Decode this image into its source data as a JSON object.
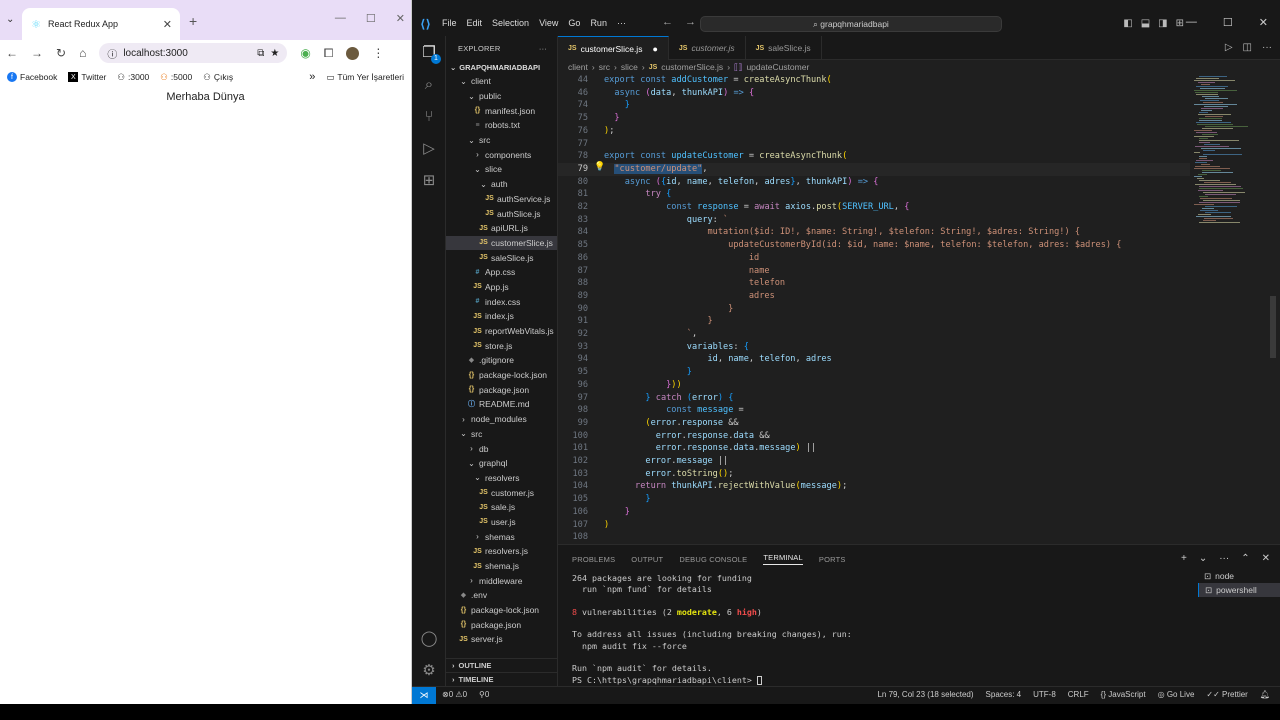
{
  "browser": {
    "tab_title": "React Redux App",
    "url": "localhost:3000",
    "bookmarks": [
      "Facebook",
      "Twitter",
      ":3000",
      ":5000",
      "Çıkış"
    ],
    "bookmarks_more": "»",
    "all_bookmarks": "Tüm Yer İşaretleri",
    "content_text": "Merhaba Dünya"
  },
  "vscode": {
    "menu": [
      "File",
      "Edit",
      "Selection",
      "View",
      "Go",
      "Run",
      "···"
    ],
    "command_center": "grapqhmariadbapi",
    "explorer_title": "EXPLORER",
    "explorer_more": "···",
    "root_folder": "GRAPQHMARIADBAPI",
    "tree": [
      {
        "label": "client",
        "icon": "chev-open"
      },
      {
        "label": "public",
        "icon": "chev-open"
      },
      {
        "label": "manifest.json",
        "icon": "json"
      },
      {
        "label": "robots.txt",
        "icon": "txt"
      },
      {
        "label": "src",
        "icon": "chev-open"
      },
      {
        "label": "components",
        "icon": "chev-closed"
      },
      {
        "label": "slice",
        "icon": "chev-open"
      },
      {
        "label": "auth",
        "icon": "chev-open"
      },
      {
        "label": "authService.js",
        "icon": "js"
      },
      {
        "label": "authSlice.js",
        "icon": "js"
      },
      {
        "label": "apiURL.js",
        "icon": "js"
      },
      {
        "label": "customerSlice.js",
        "icon": "js"
      },
      {
        "label": "saleSlice.js",
        "icon": "js"
      },
      {
        "label": "App.css",
        "icon": "css"
      },
      {
        "label": "App.js",
        "icon": "js"
      },
      {
        "label": "index.css",
        "icon": "css"
      },
      {
        "label": "index.js",
        "icon": "js"
      },
      {
        "label": "reportWebVitals.js",
        "icon": "js"
      },
      {
        "label": "store.js",
        "icon": "js"
      },
      {
        "label": ".gitignore",
        "icon": "dot"
      },
      {
        "label": "package-lock.json",
        "icon": "json"
      },
      {
        "label": "package.json",
        "icon": "json"
      },
      {
        "label": "README.md",
        "icon": "info"
      },
      {
        "label": "node_modules",
        "icon": "chev-closed"
      },
      {
        "label": "src",
        "icon": "chev-open"
      },
      {
        "label": "db",
        "icon": "chev-closed"
      },
      {
        "label": "graphql",
        "icon": "chev-open"
      },
      {
        "label": "resolvers",
        "icon": "chev-open"
      },
      {
        "label": "customer.js",
        "icon": "js"
      },
      {
        "label": "sale.js",
        "icon": "js"
      },
      {
        "label": "user.js",
        "icon": "js"
      },
      {
        "label": "shemas",
        "icon": "chev-closed"
      },
      {
        "label": "resolvers.js",
        "icon": "js"
      },
      {
        "label": "shema.js",
        "icon": "js"
      },
      {
        "label": "middleware",
        "icon": "chev-closed"
      },
      {
        "label": ".env",
        "icon": "dot"
      },
      {
        "label": "package-lock.json",
        "icon": "json"
      },
      {
        "label": "package.json",
        "icon": "json"
      },
      {
        "label": "server.js",
        "icon": "js"
      }
    ],
    "outline_label": "OUTLINE",
    "timeline_label": "TIMELINE",
    "tabs": [
      {
        "label": "customerSlice.js",
        "active": true,
        "modified": true
      },
      {
        "label": "customer.js",
        "active": false,
        "modified": false
      },
      {
        "label": "saleSlice.js",
        "active": false,
        "modified": false
      }
    ],
    "breadcrumb": [
      "client",
      "src",
      "slice",
      "customerSlice.js",
      "updateCustomer"
    ],
    "panel_tabs": [
      "PROBLEMS",
      "OUTPUT",
      "DEBUG CONSOLE",
      "TERMINAL",
      "PORTS"
    ],
    "terminal_lines": [
      "264 packages are looking for funding",
      "  run `npm fund` for details",
      "",
      "8 vulnerabilities (2 moderate, 6 high)",
      "",
      "To address all issues (including breaking changes), run:",
      "  npm audit fix --force",
      "",
      "Run `npm audit` for details.",
      "PS C:\\https\\grapqhmariadbapi\\client> "
    ],
    "terminal_vuln": {
      "count": "8",
      "pre": " vulnerabilities (2 ",
      "moderate": "moderate",
      "mid": ", 6 ",
      "high": "high",
      "post": ")"
    },
    "terminals": [
      "node",
      "powershell"
    ],
    "status": {
      "errors": "0",
      "warnings": "0",
      "ports": "0",
      "cursor": "Ln 79, Col 23 (18 selected)",
      "spaces": "Spaces: 4",
      "encoding": "UTF-8",
      "eol": "CRLF",
      "language": "JavaScript",
      "golive": "Go Live",
      "prettier": "Prettier"
    }
  },
  "colors": {
    "accent": "#0078d4",
    "browser_tabstrip": "#e9ddf7",
    "editor_bg": "#1f1f1f"
  }
}
